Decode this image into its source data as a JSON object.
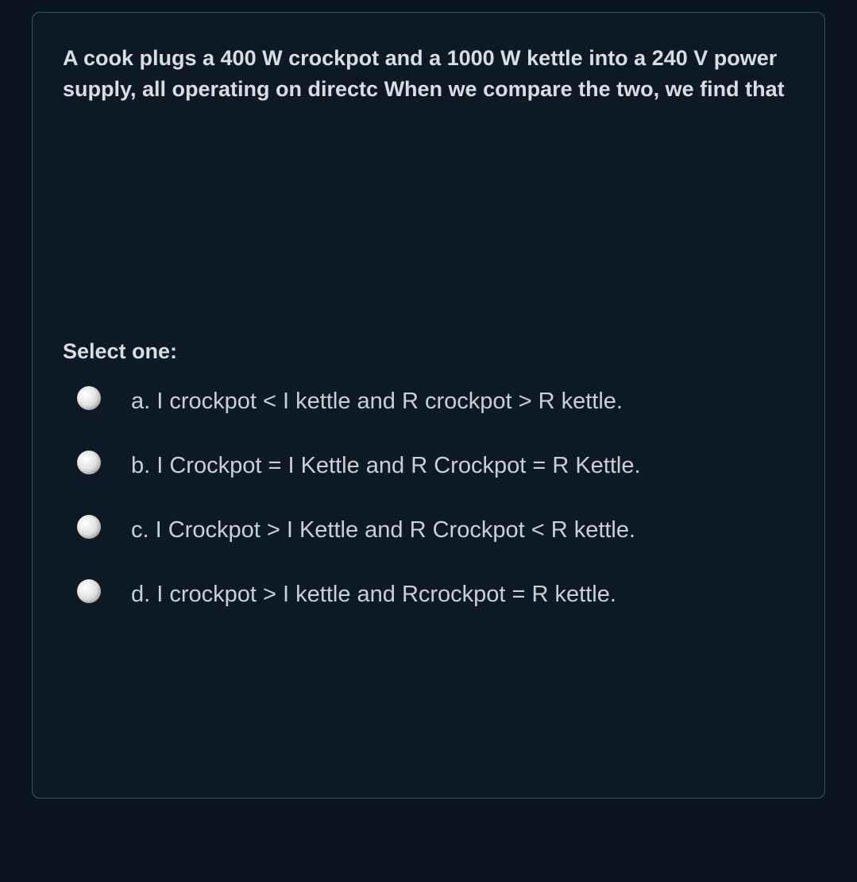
{
  "question": {
    "prompt": "A cook plugs a 400 W crockpot and a 1000 W kettle into a 240 V power supply, all operating on directc When we compare the two, we find that",
    "select_label": "Select one:",
    "options": [
      {
        "letter": "a.",
        "text": "I crockpot < I kettle and R crockpot > R kettle."
      },
      {
        "letter": "b.",
        "text": "I Crockpot = I Kettle and R Crockpot = R Kettle."
      },
      {
        "letter": "c.",
        "text": "I Crockpot > I Kettle and R Crockpot < R kettle."
      },
      {
        "letter": "d.",
        "text": "I crockpot > I kettle and Rcrockpot = R kettle."
      }
    ]
  }
}
